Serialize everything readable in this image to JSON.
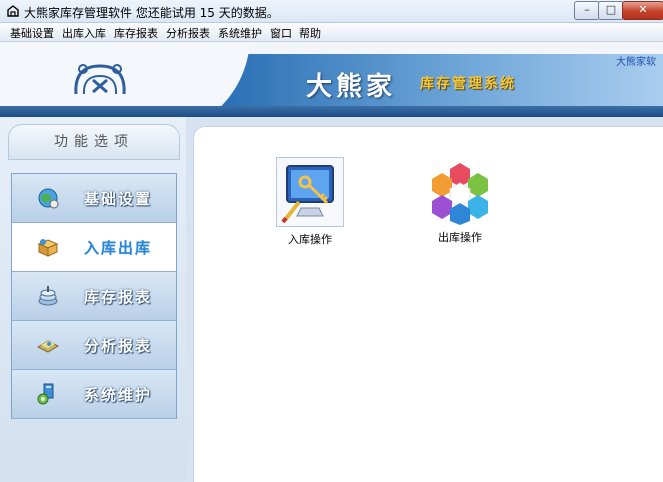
{
  "window": {
    "title": "大熊家库存管理软件  您还能试用 15 天的数据。",
    "icons": {
      "app": "house-icon",
      "minimize": "minimize-icon",
      "maximize": "maximize-icon",
      "close": "close-icon"
    },
    "min_label": "–",
    "max_label": "□",
    "close_label": "✕"
  },
  "menu": [
    {
      "label": "基础设置"
    },
    {
      "label": "出库入库"
    },
    {
      "label": "库存报表"
    },
    {
      "label": "分析报表"
    },
    {
      "label": "系统维护"
    },
    {
      "label": "窗口"
    },
    {
      "label": "帮助"
    }
  ],
  "banner": {
    "title": "大熊家",
    "subtitle": "库存管理系统",
    "corner_text": "大熊家软",
    "logo_icon": "bear-logo-icon",
    "colors": {
      "subtitle": "#f0c840",
      "corner_text": "#1f4fb0"
    }
  },
  "panel": {
    "header": "功能选项",
    "items": [
      {
        "label": "基础设置",
        "icon": "globe-settings-icon",
        "active": false
      },
      {
        "label": "入库出库",
        "icon": "box-stock-icon",
        "active": true
      },
      {
        "label": "库存报表",
        "icon": "stack-report-icon",
        "active": false
      },
      {
        "label": "分析报表",
        "icon": "analysis-report-icon",
        "active": false
      },
      {
        "label": "系统维护",
        "icon": "system-maintenance-icon",
        "active": false
      }
    ],
    "colors": {
      "active_label": "#2a86d6",
      "inactive_label": "#ffffff"
    }
  },
  "operations": [
    {
      "label": "入库操作",
      "icon": "monitor-key-icon"
    },
    {
      "label": "出库操作",
      "icon": "hexagon-cluster-icon"
    }
  ]
}
